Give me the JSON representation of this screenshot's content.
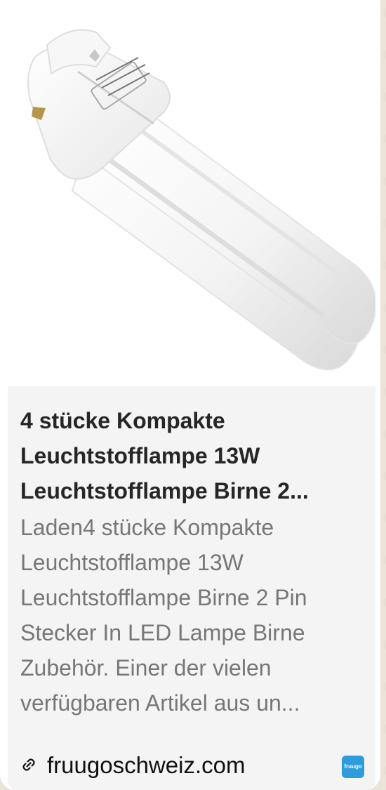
{
  "header": {
    "cut_text": "g"
  },
  "card": {
    "title": "4 stücke Kompakte Leuchtstofflampe 13W Leuchtstofflampe Birne 2...",
    "description": "Laden4 stücke Kompakte Leuchtstofflampe 13W Leuchtstofflampe Birne 2 Pin Stecker In LED Lampe Birne Zubehör. Einer der vielen verfügbaren Artikel aus un...",
    "domain": "fruugoschweiz.com",
    "badge_text": "fruugo"
  },
  "icons": {
    "link": "link-icon",
    "site_badge": "fruugo-badge-icon"
  },
  "colors": {
    "card_bg": "#f4f4f4",
    "title": "#262626",
    "description": "#777777",
    "badge": "#2d9cdb"
  }
}
